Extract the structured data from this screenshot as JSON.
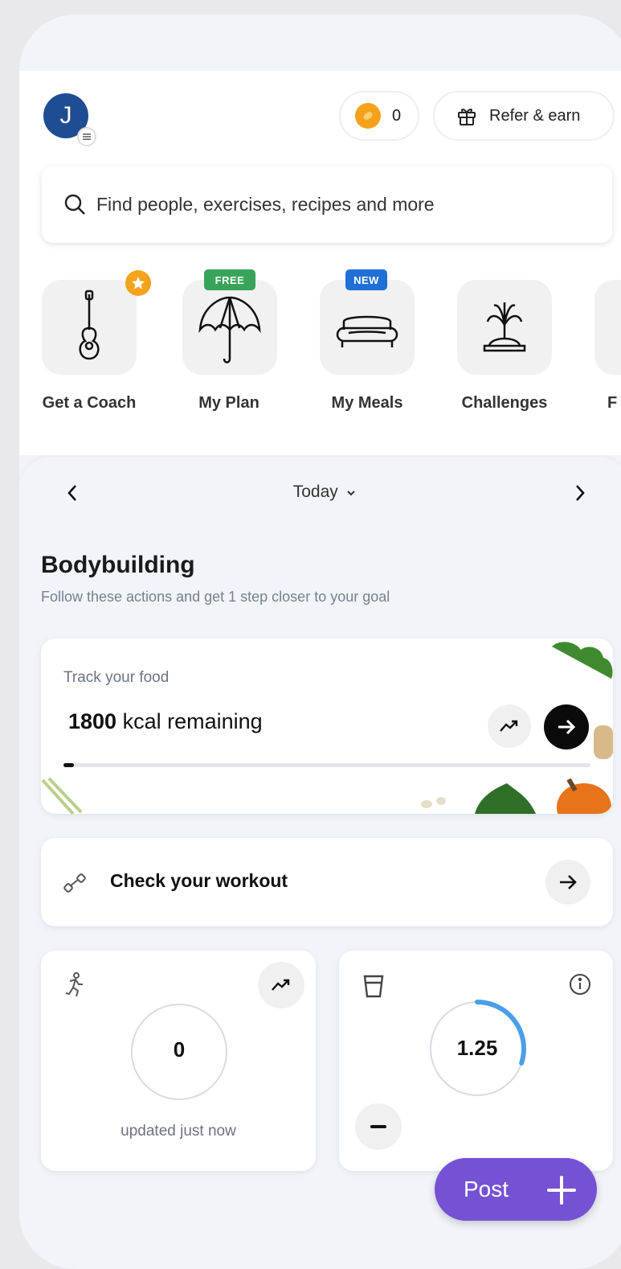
{
  "header": {
    "avatar_initial": "J",
    "coins": "0",
    "refer_label": "Refer & earn"
  },
  "search": {
    "placeholder": "Find people, exercises, recipes and more"
  },
  "shortcuts": [
    {
      "label": "Get a Coach",
      "icon": "guitar-icon",
      "badge": ""
    },
    {
      "label": "My Plan",
      "icon": "umbrella-icon",
      "badge": "FREE"
    },
    {
      "label": "My Meals",
      "icon": "sofa-icon",
      "badge": "NEW"
    },
    {
      "label": "Challenges",
      "icon": "fountain-icon",
      "badge": ""
    },
    {
      "label": "F",
      "icon": "",
      "badge": ""
    }
  ],
  "date_nav": {
    "label": "Today"
  },
  "plan": {
    "title": "Bodybuilding",
    "subtitle": "Follow these actions and get 1 step closer to your goal"
  },
  "food_card": {
    "caption": "Track your food",
    "kcal_value": "1800",
    "kcal_text": "kcal remaining",
    "progress": 0.02
  },
  "workout_card": {
    "label": "Check your workout"
  },
  "steps_card": {
    "value": "0",
    "status": "updated just now"
  },
  "water_card": {
    "value": "1.25",
    "progress": 0.3
  },
  "fab": {
    "label": "Post"
  },
  "colors": {
    "accent": "#7552d3",
    "avatar": "#1f4d91",
    "ring": "#4a9fe8",
    "free_badge": "#3aa35a",
    "new_badge": "#1f6fd6"
  }
}
